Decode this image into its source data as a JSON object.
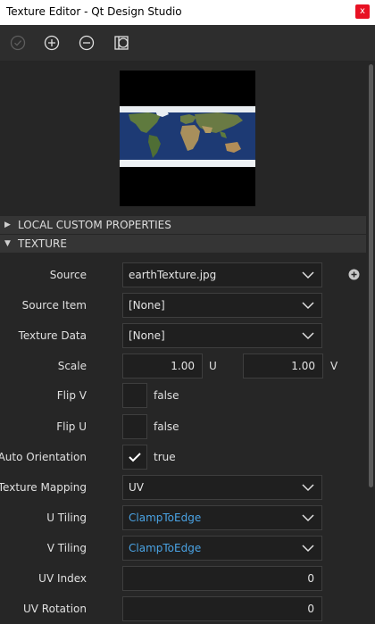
{
  "window": {
    "title": "Texture Editor - Qt Design Studio",
    "close_glyph": "x"
  },
  "toolbar": {
    "buttons": [
      {
        "name": "apply-button",
        "icon": "check-circle-icon"
      },
      {
        "name": "add-texture-button",
        "icon": "plus-circle-icon"
      },
      {
        "name": "remove-texture-button",
        "icon": "minus-circle-icon"
      },
      {
        "name": "material-browser-button",
        "icon": "material-icon"
      }
    ]
  },
  "sections": {
    "local_custom": {
      "title": "LOCAL CUSTOM PROPERTIES",
      "expanded": false
    },
    "texture": {
      "title": "TEXTURE",
      "expanded": true
    }
  },
  "properties": {
    "source": {
      "label": "Source",
      "value": "earthTexture.jpg"
    },
    "source_item": {
      "label": "Source Item",
      "value": "[None]"
    },
    "texture_data": {
      "label": "Texture Data",
      "value": "[None]"
    },
    "scale": {
      "label": "Scale",
      "u_value": "1.00",
      "u_unit": "U",
      "v_value": "1.00",
      "v_unit": "V"
    },
    "flip_v": {
      "label": "Flip V",
      "checked": false,
      "text": "false"
    },
    "flip_u": {
      "label": "Flip U",
      "checked": false,
      "text": "false"
    },
    "auto_orientation": {
      "label": "Auto Orientation",
      "checked": true,
      "text": "true"
    },
    "texture_mapping": {
      "label": "Texture Mapping",
      "value": "UV"
    },
    "u_tiling": {
      "label": "U Tiling",
      "value": "ClampToEdge"
    },
    "v_tiling": {
      "label": "V Tiling",
      "value": "ClampToEdge"
    },
    "uv_index": {
      "label": "UV Index",
      "value": "0"
    },
    "uv_rotation": {
      "label": "UV Rotation",
      "value": "0"
    }
  },
  "colors": {
    "background": "#262626",
    "link": "#4aa3e4",
    "close": "#e81123"
  }
}
